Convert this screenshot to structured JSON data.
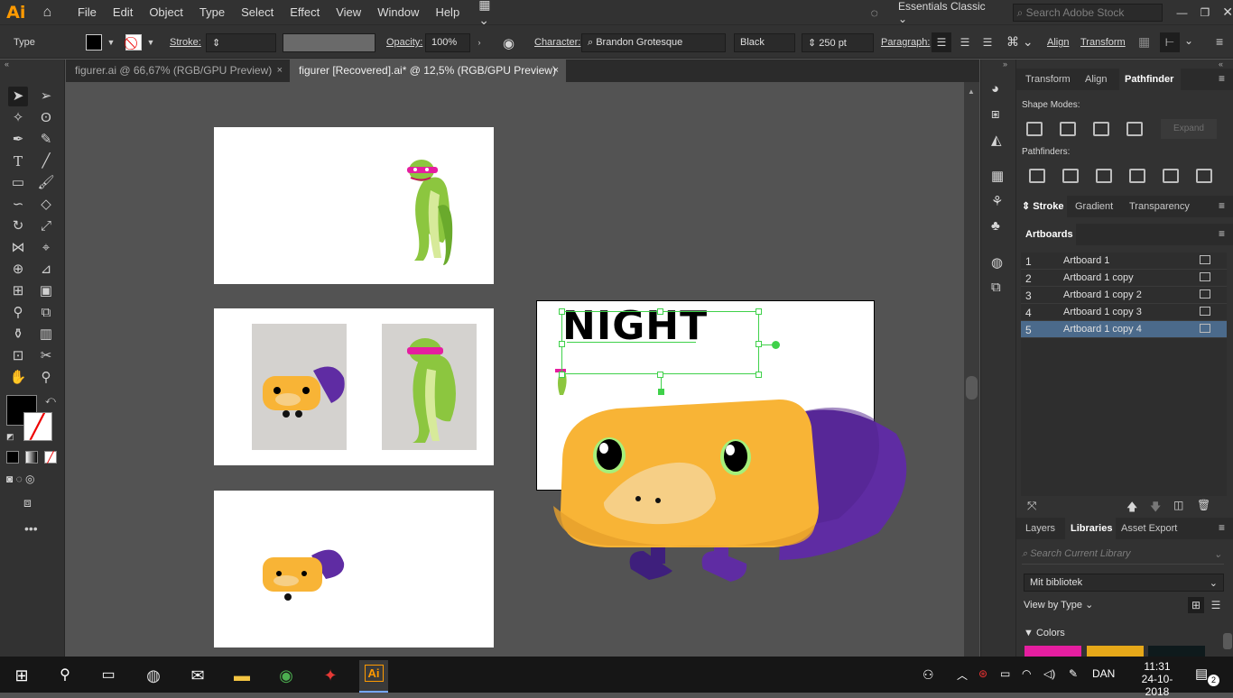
{
  "app": {
    "logo": "Ai",
    "workspace": "Essentials Classic",
    "search_placeholder": "Search Adobe Stock"
  },
  "menu": [
    "File",
    "Edit",
    "Object",
    "Type",
    "Select",
    "Effect",
    "View",
    "Window",
    "Help"
  ],
  "control": {
    "tool_label": "Type",
    "stroke_label": "Stroke:",
    "opacity_label": "Opacity:",
    "opacity_value": "100%",
    "character_label": "Character:",
    "font_family": "Brandon Grotesque",
    "font_style": "Black",
    "font_size": "250 pt",
    "paragraph_label": "Paragraph:",
    "align_label": "Align",
    "transform_label": "Transform"
  },
  "doc_tabs": [
    {
      "title": "figurer.ai @ 66,67% (RGB/GPU Preview)",
      "close": "×"
    },
    {
      "title": "figurer [Recovered].ai* @ 12,5% (RGB/GPU Preview)",
      "close": "×"
    }
  ],
  "canvas": {
    "headline": "NIGHT"
  },
  "panels": {
    "top_tabs": [
      "Transform",
      "Align",
      "Pathfinder"
    ],
    "shape_modes_label": "Shape Modes:",
    "expand_label": "Expand",
    "pathfinders_label": "Pathfinders:",
    "stroke_tabs": [
      "Stroke",
      "Gradient",
      "Transparency"
    ],
    "artboards_title": "Artboards",
    "artboards": [
      {
        "num": "1",
        "name": "Artboard 1"
      },
      {
        "num": "2",
        "name": "Artboard 1 copy"
      },
      {
        "num": "3",
        "name": "Artboard 1 copy 2"
      },
      {
        "num": "4",
        "name": "Artboard 1 copy 3"
      },
      {
        "num": "5",
        "name": "Artboard 1 copy 4"
      }
    ],
    "selected_artboard_index": 4,
    "bottom_tabs": [
      "Layers",
      "Libraries",
      "Asset Export"
    ],
    "library_search_placeholder": "Search Current Library",
    "library_name": "Mit bibliotek",
    "view_by": "View by Type",
    "colors_label": "Colors",
    "swatches": [
      "#e51ea0",
      "#e6a819",
      "#0e1a1c"
    ]
  },
  "taskbar": {
    "language": "DAN",
    "time": "11:31",
    "date": "24-10-2018",
    "notifications": "2"
  },
  "colors": {
    "accent": "#ff9a00",
    "chrome": "#323232",
    "canvas": "#535353",
    "selection_green": "#3fd14a",
    "yellow_character": "#f8b436",
    "purple_tail": "#5f2ca3",
    "green_character": "#8cc63f"
  }
}
